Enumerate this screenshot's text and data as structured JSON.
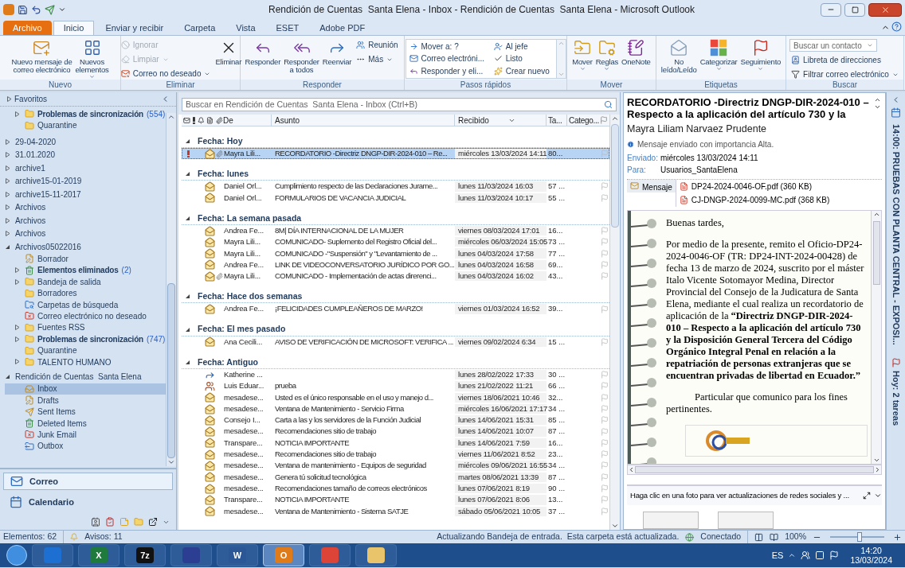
{
  "window": {
    "title": "Rendición de Cuentas  Santa Elena - Inbox - Rendición de Cuentas  Santa Elena - Microsoft Outlook"
  },
  "ribbon_tabs": [
    {
      "label": "Archivo",
      "kind": "file",
      "selected": false
    },
    {
      "label": "Inicio",
      "kind": "tab",
      "selected": true
    },
    {
      "label": "Enviar y recibir",
      "kind": "tab",
      "selected": false
    },
    {
      "label": "Carpeta",
      "kind": "tab",
      "selected": false
    },
    {
      "label": "Vista",
      "kind": "tab",
      "selected": false
    },
    {
      "label": "ESET",
      "kind": "tab",
      "selected": false
    },
    {
      "label": "Adobe PDF",
      "kind": "tab",
      "selected": false
    }
  ],
  "ribbon_groups": [
    {
      "label": "Nuevo",
      "items": [
        {
          "kind": "large",
          "label": "Nuevo mensaje de\ncorreo electrónico",
          "dropdown": false,
          "disabled": false
        },
        {
          "kind": "large",
          "label": "Nuevos\nelementos",
          "dropdown": true,
          "disabled": false
        }
      ]
    },
    {
      "label": "Eliminar",
      "items": [
        {
          "kind": "stack",
          "items": [
            {
              "label": "Ignorar",
              "dropdown": false,
              "disabled": true
            },
            {
              "label": "Limpiar",
              "dropdown": true,
              "disabled": true
            },
            {
              "label": "Correo no deseado",
              "dropdown": true,
              "disabled": false
            }
          ]
        },
        {
          "kind": "large",
          "label": "Eliminar",
          "dropdown": false,
          "disabled": false
        }
      ]
    },
    {
      "label": "Responder",
      "items": [
        {
          "kind": "large",
          "label": "Responder",
          "dropdown": false,
          "disabled": false
        },
        {
          "kind": "large",
          "label": "Responder\na todos",
          "dropdown": false,
          "disabled": false
        },
        {
          "kind": "large",
          "label": "Reenviar",
          "dropdown": false,
          "disabled": false
        },
        {
          "kind": "stack",
          "items": [
            {
              "label": "Reunión",
              "dropdown": false,
              "disabled": false
            },
            {
              "label": "Más",
              "dropdown": true,
              "disabled": false
            }
          ]
        }
      ]
    },
    {
      "label": "Pasos rápidos",
      "items": [
        {
          "kind": "gallery",
          "items": [
            {
              "label": "Mover a: ?",
              "disabled": false
            },
            {
              "label": "Al jefe",
              "disabled": false
            },
            {
              "label": "Correo electróni...",
              "disabled": false
            },
            {
              "label": "Listo",
              "disabled": false
            },
            {
              "label": "Responder y eli...",
              "disabled": false
            },
            {
              "label": "Crear nuevo",
              "disabled": false
            }
          ]
        }
      ]
    },
    {
      "label": "Mover",
      "items": [
        {
          "kind": "large",
          "label": "Mover",
          "dropdown": true,
          "disabled": false
        },
        {
          "kind": "large",
          "label": "Reglas",
          "dropdown": true,
          "disabled": false
        },
        {
          "kind": "large",
          "label": "OneNote",
          "dropdown": false,
          "disabled": false
        }
      ]
    },
    {
      "label": "Etiquetas",
      "items": [
        {
          "kind": "large",
          "label": "No\nleído/Leído",
          "dropdown": false,
          "disabled": false
        },
        {
          "kind": "large",
          "label": "Categorizar",
          "dropdown": true,
          "disabled": false
        },
        {
          "kind": "large",
          "label": "Seguimiento",
          "dropdown": true,
          "disabled": false
        }
      ]
    },
    {
      "label": "Buscar",
      "items": [
        {
          "kind": "search",
          "placeholder": "Buscar un contacto",
          "items": [
            {
              "label": "Libreta de direcciones",
              "dropdown": false,
              "disabled": false
            },
            {
              "label": "Filtrar correo electrónico",
              "dropdown": true,
              "disabled": false
            }
          ]
        }
      ]
    }
  ],
  "nav": {
    "header": "Favoritos",
    "folders": [
      {
        "label": "Problemas de sincronización",
        "count": "(554)",
        "bold": true,
        "expanded": false,
        "kind": "folder",
        "selected": false
      },
      {
        "label": "Quarantine",
        "kind": "folder",
        "bold": false,
        "selected": false
      }
    ],
    "stores": [
      {
        "label": "29-04-2020",
        "expanded": false,
        "selected": false
      },
      {
        "label": "31.01.2020",
        "expanded": false,
        "selected": false
      },
      {
        "label": "archive1",
        "expanded": false,
        "selected": false
      },
      {
        "label": "archive15-01-2019",
        "expanded": false,
        "selected": false
      },
      {
        "label": "archive15-11-2017",
        "expanded": false,
        "selected": false
      },
      {
        "label": "Archivos",
        "expanded": false,
        "selected": false
      },
      {
        "label": "Archivos",
        "expanded": false,
        "selected": false
      },
      {
        "label": "Archivos",
        "expanded": false,
        "selected": false
      },
      {
        "label": "Archivos05022016",
        "expanded": true,
        "selected": false,
        "children": [
          {
            "label": "Borrador",
            "kind": "drafts",
            "bold": false,
            "selected": false
          },
          {
            "label": "Elementos eliminados",
            "count": "(2)",
            "kind": "deleted",
            "bold": true,
            "expanded": false,
            "selected": false
          },
          {
            "label": "Bandeja de salida",
            "kind": "folder",
            "bold": false,
            "expanded": false,
            "selected": false
          },
          {
            "label": "Borradores",
            "kind": "folder",
            "bold": false,
            "selected": false
          },
          {
            "label": "Carpetas de búsqueda",
            "kind": "search",
            "bold": false,
            "selected": false
          },
          {
            "label": "Correo electrónico no deseado",
            "kind": "junk",
            "bold": false,
            "selected": false
          },
          {
            "label": "Fuentes RSS",
            "kind": "folder",
            "bold": false,
            "expanded": false,
            "selected": false
          },
          {
            "label": "Problemas de sincronización",
            "count": "(747)",
            "kind": "folder",
            "bold": true,
            "expanded": false,
            "selected": false
          },
          {
            "label": "Quarantine",
            "kind": "folder",
            "bold": false,
            "selected": false
          },
          {
            "label": "TALENTO HUMANO",
            "kind": "folder",
            "bold": false,
            "expanded": false,
            "selected": false
          }
        ]
      },
      {
        "label": "Rendición de Cuentas  Santa Elena",
        "expanded": true,
        "selected": false,
        "children": [
          {
            "label": "Inbox",
            "kind": "inbox",
            "bold": false,
            "selected": true
          },
          {
            "label": "Drafts",
            "kind": "drafts",
            "bold": false,
            "selected": false
          },
          {
            "label": "Sent Items",
            "kind": "sent",
            "bold": false,
            "selected": false
          },
          {
            "label": "Deleted Items",
            "kind": "deleted",
            "bold": false,
            "selected": false
          },
          {
            "label": "Junk Email",
            "kind": "junk",
            "bold": false,
            "selected": false
          },
          {
            "label": "Outbox",
            "kind": "outbox",
            "bold": false,
            "selected": false
          }
        ]
      }
    ],
    "buttons": [
      {
        "label": "Correo",
        "kind": "mail",
        "selected": true
      },
      {
        "label": "Calendario",
        "kind": "calendar",
        "selected": false
      }
    ]
  },
  "mail_list": {
    "search_placeholder": "Buscar en Rendición de Cuentas  Santa Elena - Inbox (Ctrl+B)",
    "columns": [
      "De",
      "Asunto",
      "Recibido",
      "Ta...",
      "Catego..."
    ],
    "groups": [
      {
        "label": "Fecha: Hoy",
        "expanded": true,
        "rows": [
          {
            "kind": "mail",
            "from": "Mayra Lili...",
            "subject": "RECORDATORIO -Directriz DNGP-DIR-2024-010 – Re...",
            "received": "miércoles 13/03/2024 14:11",
            "size": "80...",
            "important": true,
            "attachment": true,
            "selected": true
          }
        ]
      },
      {
        "label": "Fecha: lunes",
        "expanded": true,
        "rows": [
          {
            "kind": "mail",
            "from": "Daniel Orl...",
            "subject": "Cumplimiento respecto de las Declaraciones Jurame...",
            "received": "lunes 11/03/2024 16:03",
            "size": "57 ...",
            "important": false,
            "attachment": false,
            "selected": false
          },
          {
            "kind": "mail",
            "from": "Daniel Orl...",
            "subject": "FORMULARIOS DE VACANCIA JUDICIAL",
            "received": "lunes 11/03/2024 10:17",
            "size": "55 ...",
            "important": false,
            "attachment": false,
            "selected": false
          }
        ]
      },
      {
        "label": "Fecha: La semana pasada",
        "expanded": true,
        "rows": [
          {
            "kind": "mail",
            "from": "Andrea Fe...",
            "subject": "8M| DÍA INTERNACIONAL DE LA MUJER",
            "received": "viernes 08/03/2024 17:01",
            "size": "16...",
            "important": false,
            "attachment": false,
            "selected": false
          },
          {
            "kind": "mail",
            "from": "Mayra Lili...",
            "subject": "COMUNICADO- Suplemento del Registro Oficial del...",
            "received": "miércoles 06/03/2024 15:05",
            "size": "73 ...",
            "important": false,
            "attachment": false,
            "selected": false
          },
          {
            "kind": "mail",
            "from": "Mayra Lili...",
            "subject": "COMUNICADO -\"Suspensión\" y \"Levantamiento de ...",
            "received": "lunes 04/03/2024 17:58",
            "size": "77 ...",
            "important": false,
            "attachment": false,
            "selected": false
          },
          {
            "kind": "mail",
            "from": "Andrea Fe...",
            "subject": "LINK DE VIDEOCONVERSATORIO JURÍDICO POR GO...",
            "received": "lunes 04/03/2024 16:58",
            "size": "69...",
            "important": false,
            "attachment": false,
            "selected": false
          },
          {
            "kind": "mail",
            "from": "Mayra Lili...",
            "subject": "COMUNICADO - Implementación de actas direrenci...",
            "received": "lunes 04/03/2024 16:02",
            "size": "43...",
            "important": false,
            "attachment": true,
            "selected": false
          }
        ]
      },
      {
        "label": "Fecha: Hace dos semanas",
        "expanded": true,
        "rows": [
          {
            "kind": "mail",
            "from": "Andrea Fe...",
            "subject": "¡FELICIDADES CUMPLEAÑEROS DE MARZO!",
            "received": "viernes 01/03/2024 16:52",
            "size": "39...",
            "important": false,
            "attachment": false,
            "selected": false
          }
        ]
      },
      {
        "label": "Fecha: El mes pasado",
        "expanded": true,
        "rows": [
          {
            "kind": "mail",
            "from": "Ana Cecili...",
            "subject": "AVISO DE VERIFICACIÓN DE MICROSOFT: VERIFICA ...",
            "received": "viernes 09/02/2024 6:34",
            "size": "15 ...",
            "important": false,
            "attachment": false,
            "selected": false
          }
        ]
      },
      {
        "label": "Fecha: Antiguo",
        "expanded": true,
        "rows": [
          {
            "kind": "forwarded",
            "from": "Katherine ...",
            "received": "lunes 28/02/2022 17:33",
            "size": "30 ...",
            "important": false,
            "attachment": false,
            "selected": false
          },
          {
            "kind": "meeting",
            "from": "Luis Eduar...",
            "subject": "prueba",
            "received": "lunes 21/02/2022 11:21",
            "size": "66 ...",
            "important": false,
            "attachment": false,
            "selected": false
          },
          {
            "kind": "mail",
            "from": "mesadese...",
            "subject": "Usted es el único responsable en el uso y manejo d...",
            "received": "viernes 18/06/2021 10:46",
            "size": "32...",
            "important": false,
            "attachment": false,
            "selected": false
          },
          {
            "kind": "mail",
            "from": "mesadese...",
            "subject": "Ventana de Mantenimiento - Servicio Firma",
            "received": "miércoles 16/06/2021 17:17",
            "size": "34 ...",
            "important": false,
            "attachment": false,
            "selected": false
          },
          {
            "kind": "mail",
            "from": "Consejo I...",
            "subject": "Carta a las y los servidores de la Función Judicial",
            "received": "lunes 14/06/2021 15:31",
            "size": "85 ...",
            "important": false,
            "attachment": false,
            "selected": false
          },
          {
            "kind": "mail",
            "from": "mesadese...",
            "subject": "Recomendaciones sitio de trabajo",
            "received": "lunes 14/06/2021 10:07",
            "size": "87 ...",
            "important": false,
            "attachment": false,
            "selected": false
          },
          {
            "kind": "mail",
            "from": "Transpare...",
            "subject": "NOTICIA IMPORTANTE",
            "received": "lunes 14/06/2021 7:59",
            "size": "16...",
            "important": false,
            "attachment": false,
            "selected": false
          },
          {
            "kind": "mail",
            "from": "mesadese...",
            "subject": "Recomendaciones sitio de trabajo",
            "received": "viernes 11/06/2021 8:52",
            "size": "23...",
            "important": false,
            "attachment": false,
            "selected": false
          },
          {
            "kind": "mail",
            "from": "mesadese...",
            "subject": "Ventana de mantenimiento - Equipos de seguridad",
            "received": "miércoles 09/06/2021 16:55",
            "size": "34 ...",
            "important": false,
            "attachment": false,
            "selected": false
          },
          {
            "kind": "mail",
            "from": "mesadese...",
            "subject": "Genera tú solicitud tecnológica",
            "received": "martes 08/06/2021 13:39",
            "size": "87 ...",
            "important": false,
            "attachment": false,
            "selected": false
          },
          {
            "kind": "mail",
            "from": "mesadese...",
            "subject": "Recomendaciones tamaño de correos electrónicos",
            "received": "lunes 07/06/2021 8:19",
            "size": "90 ...",
            "important": false,
            "attachment": false,
            "selected": false
          },
          {
            "kind": "mail",
            "from": "Transpare...",
            "subject": "NOTICIA IMPORTANTE",
            "received": "lunes 07/06/2021 8:06",
            "size": "13...",
            "important": false,
            "attachment": false,
            "selected": false
          },
          {
            "kind": "mail",
            "from": "mesadese...",
            "subject": "Ventana de Mantenimiento - Sistema SATJE",
            "received": "sábado 05/06/2021 10:05",
            "size": "37 ...",
            "important": false,
            "attachment": false,
            "selected": false
          }
        ]
      }
    ]
  },
  "reading_pane": {
    "subject": "RECORDATORIO -Directriz DNGP-DIR-2024-010 – Respecto a la aplicación del artículo 730 y la",
    "sender": "Mayra Liliam Narvaez Prudente",
    "importance_note": "Mensaje enviado con importancia Alta.",
    "sent_label": "Enviado:",
    "sent": "miércoles 13/03/2024 14:11",
    "to_label": "Para:",
    "to": "Usuarios_SantaElena",
    "message_tab": "Mensaje",
    "attachments": [
      "DP24-2024-0046-OF.pdf (360 KB)",
      "CJ-DNGP-2024-0099-MC.pdf (368 KB)"
    ],
    "body": [
      {
        "kind": "greeting",
        "text": "Buenas tardes,"
      },
      {
        "kind": "paragraph",
        "text": "Por medio de la presente, remito el Oficio-DP24-2024-0046-OF (TR: DP24-INT-2024-00428) de fecha 13 de marzo de 2024, suscrito por el máster Italo Vicente Sotomayor Medina,  Director Provincial del Consejo de la Judicatura de Santa Elena, mediante el cual realiza un recordatorio de aplicación de la **“Directriz DNGP-DIR-2024-010 – Respecto a la aplicación del artículo 730 y la Disposición General Tercera del Código Orgánico Integral Penal en relación a la repatriación de personas extranjeras que se encuentran privadas de libertad en Ecuador.”**"
      },
      {
        "kind": "closing",
        "text": "Particular que comunico para los fines pertinentes."
      }
    ],
    "social_bar": "Haga clic en una foto para ver actualizaciones de redes sociales y ..."
  },
  "todo_bar": {
    "appointment": "14:00: PRUEBAS CON PLANTA CENTRAL - EXPOSI...",
    "tasks": "Hoy: 2 tareas"
  },
  "status_bar": {
    "items": "Elementos: 62",
    "reminders": "Avisos: 11",
    "message": "Actualizando Bandeja de entrada.  Esta carpeta está actualizada.",
    "connection": "Conectado",
    "zoom": "100%",
    "level": 0.55
  },
  "taskbar": {
    "apps": [
      {
        "kind": "browser",
        "active": false
      },
      {
        "kind": "sheet",
        "glyph": "X",
        "active": false
      },
      {
        "kind": "archive",
        "glyph": "7z",
        "active": false
      },
      {
        "kind": "installer",
        "active": false
      },
      {
        "kind": "doc",
        "glyph": "W",
        "active": false
      },
      {
        "kind": "mail",
        "glyph": "O",
        "active": true
      },
      {
        "kind": "chrome",
        "active": false
      },
      {
        "kind": "files",
        "active": false
      }
    ],
    "language": "ES",
    "time": "14:20",
    "date": "13/03/2024"
  }
}
